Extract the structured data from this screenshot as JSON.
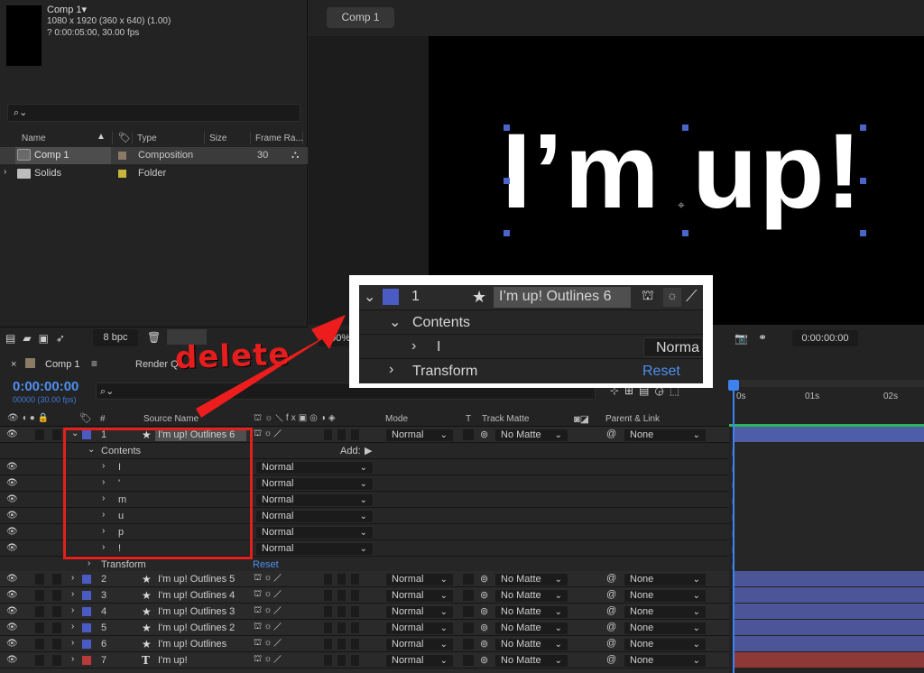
{
  "project": {
    "comp_name": "Comp 1",
    "comp_dropdown_glyph": "▾",
    "comp_res": "1080 x 1920  (360 x 640) (1.00)",
    "comp_duration": "? 0:00:05:00, 30.00 fps",
    "search_placeholder": "",
    "columns": {
      "name": "Name",
      "type": "Type",
      "size": "Size",
      "frame_rate": "Frame Ra..."
    },
    "items": [
      {
        "name": "Comp 1",
        "type": "Composition",
        "frame_rate": "30",
        "swatch": "#8a7a66"
      },
      {
        "name": "Solids",
        "type": "Folder",
        "frame_rate": "",
        "swatch": "#c9b43c"
      }
    ],
    "bpc": "8 bpc"
  },
  "viewer": {
    "tab": "Comp 1",
    "canvas_text": "I’m up!",
    "zoom": "100%",
    "timecode": "0:00:00:00"
  },
  "timeline": {
    "tab": "Comp 1",
    "render_tab": "Render Qu",
    "timecode": "0:00:00:00",
    "fps": "00000 (30.00 fps)",
    "headers": {
      "hash": "#",
      "source_name": "Source Name",
      "mode": "Mode",
      "t": "T",
      "track_matte": "Track Matte",
      "parent": "Parent & Link"
    },
    "ruler": [
      "0s",
      "01s",
      "02s"
    ],
    "add_label": "Add:",
    "contents_label": "Contents",
    "transform_label": "Transform",
    "reset_label": "Reset",
    "expanded_layer": {
      "num": "1",
      "name": "I'm up! Outlines 6",
      "mode": "Normal",
      "matte": "No Matte",
      "parent": "None"
    },
    "sub_items": [
      {
        "name": "I",
        "mode": "Normal"
      },
      {
        "name": "'",
        "mode": "Normal"
      },
      {
        "name": "m",
        "mode": "Normal"
      },
      {
        "name": "u",
        "mode": "Normal"
      },
      {
        "name": "p",
        "mode": "Normal"
      },
      {
        "name": "!",
        "mode": "Normal"
      }
    ],
    "layers": [
      {
        "num": "2",
        "name": "I'm up! Outlines 5",
        "mode": "Normal",
        "matte": "No Matte",
        "parent": "None",
        "color": "#4a5cc4",
        "type": "★"
      },
      {
        "num": "3",
        "name": "I'm up! Outlines 4",
        "mode": "Normal",
        "matte": "No Matte",
        "parent": "None",
        "color": "#4a5cc4",
        "type": "★"
      },
      {
        "num": "4",
        "name": "I'm up! Outlines 3",
        "mode": "Normal",
        "matte": "No Matte",
        "parent": "None",
        "color": "#4a5cc4",
        "type": "★"
      },
      {
        "num": "5",
        "name": "I'm up! Outlines 2",
        "mode": "Normal",
        "matte": "No Matte",
        "parent": "None",
        "color": "#4a5cc4",
        "type": "★"
      },
      {
        "num": "6",
        "name": "I'm up! Outlines",
        "mode": "Normal",
        "matte": "No Matte",
        "parent": "None",
        "color": "#4a5cc4",
        "type": "★"
      },
      {
        "num": "7",
        "name": "I'm up!",
        "mode": "Normal",
        "matte": "No Matte",
        "parent": "None",
        "color": "#b83a3a",
        "type": "T"
      }
    ]
  },
  "callout": {
    "num": "1",
    "name": "I’m up! Outlines 6",
    "contents": "Contents",
    "sub": "I",
    "mode": "Norma",
    "transform": "Transform",
    "reset": "Reset"
  },
  "annotation": {
    "text": "delete",
    "color": "#e51d1d"
  },
  "colors": {
    "accent": "#3c82f0",
    "label_blue": "#4a5cc4",
    "label_red": "#b83a3a"
  }
}
